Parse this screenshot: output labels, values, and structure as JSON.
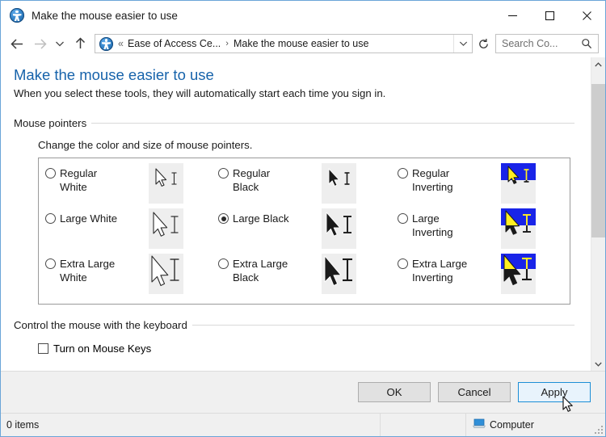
{
  "window": {
    "title": "Make the mouse easier to use",
    "title_icon": "ease-of-access-icon",
    "minimize_label": "─",
    "maximize_label": "□",
    "close_label": "✕"
  },
  "nav": {
    "back_icon": "back-arrow-icon",
    "forward_icon": "forward-arrow-icon",
    "recent_icon": "recent-locations-chevron-icon",
    "up_icon": "up-arrow-icon",
    "address_icon": "ease-of-access-icon",
    "address_prefix": "«",
    "breadcrumb": [
      "Ease of Access Ce...",
      "Make the mouse easier to use"
    ],
    "breadcrumb_sep": "›",
    "dropdown_icon": "chevron-down-icon",
    "refresh_icon": "refresh-icon",
    "search_placeholder": "Search Co...",
    "search_icon": "search-icon"
  },
  "page": {
    "title": "Make the mouse easier to use",
    "subtitle": "When you select these tools, they will automatically start each time you sign in."
  },
  "sections": {
    "mouse_pointers": {
      "heading": "Mouse pointers",
      "note": "Change the color and size of mouse pointers.",
      "options": [
        {
          "label": "Regular\nWhite",
          "style": "white",
          "size": "regular",
          "checked": false
        },
        {
          "label": "Regular\nBlack",
          "style": "black",
          "size": "regular",
          "checked": false
        },
        {
          "label": "Regular\nInverting",
          "style": "inverting",
          "size": "regular",
          "checked": false
        },
        {
          "label": "Large White",
          "style": "white",
          "size": "large",
          "checked": false
        },
        {
          "label": "Large Black",
          "style": "black",
          "size": "large",
          "checked": true
        },
        {
          "label": "Large\nInverting",
          "style": "inverting",
          "size": "large",
          "checked": false
        },
        {
          "label": "Extra Large\nWhite",
          "style": "white",
          "size": "xlarge",
          "checked": false
        },
        {
          "label": "Extra Large\nBlack",
          "style": "black",
          "size": "xlarge",
          "checked": false
        },
        {
          "label": "Extra Large\nInverting",
          "style": "inverting",
          "size": "xlarge",
          "checked": false
        }
      ]
    },
    "keyboard": {
      "heading": "Control the mouse with the keyboard",
      "checkbox_label": "Turn on Mouse Keys",
      "checkbox_checked": false
    }
  },
  "buttons": {
    "ok": "OK",
    "cancel": "Cancel",
    "apply": "Apply",
    "apply_state": "hover"
  },
  "statusbar": {
    "items": "0 items",
    "computer": "Computer",
    "computer_icon": "computer-icon"
  },
  "colors": {
    "accent_blue": "#1763ab",
    "window_border": "#6aa5d8",
    "hover_button_bg": "#e8f3fc",
    "hover_button_border": "#1c8ed6",
    "inverting_blue": "#1924e8",
    "inverting_yellow": "#ffee22",
    "preview_bg": "#eeeeee"
  },
  "scrollbar": {
    "up_icon": "chevron-up-icon",
    "down_icon": "chevron-down-icon"
  }
}
